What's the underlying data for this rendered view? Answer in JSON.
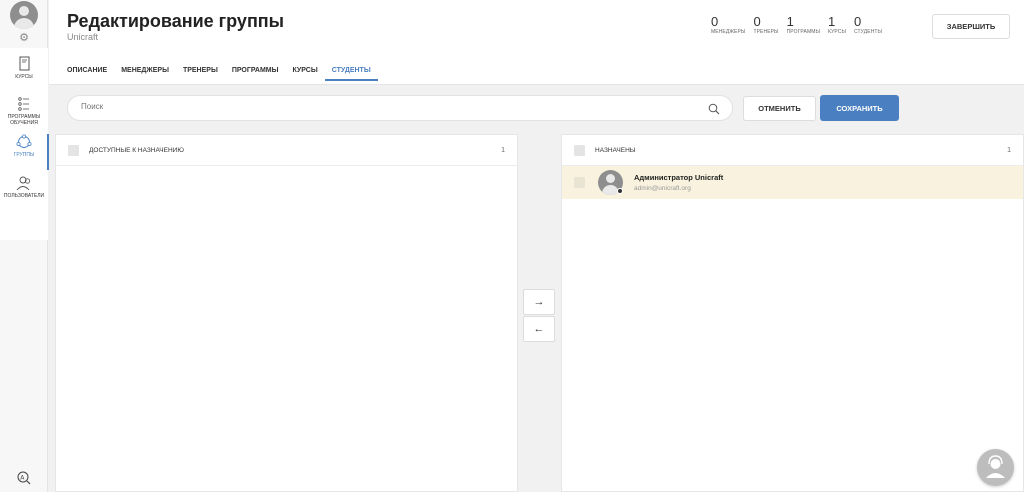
{
  "sidebar": {
    "items": [
      {
        "label": "КУРСЫ",
        "icon": "course-book-icon"
      },
      {
        "label": "ПРОГРАММЫ ОБУЧЕНИЯ",
        "icon": "program-list-icon"
      },
      {
        "label": "ГРУППЫ",
        "icon": "groups-icon"
      },
      {
        "label": "ПОЛЬЗОВАТЕЛИ",
        "icon": "users-icon"
      }
    ],
    "active": "ГРУППЫ"
  },
  "header": {
    "title": "Редактирование группы",
    "subtitle": "Unicraft",
    "finish_label": "ЗАВЕРШИТЬ",
    "stats": [
      {
        "value": "0",
        "label": "МЕНЕДЖЕРЫ"
      },
      {
        "value": "0",
        "label": "ТРЕНЕРЫ"
      },
      {
        "value": "1",
        "label": "ПРОГРАММЫ"
      },
      {
        "value": "1",
        "label": "КУРСЫ"
      },
      {
        "value": "0",
        "label": "СТУДЕНТЫ"
      }
    ],
    "tabs": [
      "ОПИСАНИЕ",
      "МЕНЕДЖЕРЫ",
      "ТРЕНЕРЫ",
      "ПРОГРАММЫ",
      "КУРСЫ",
      "СТУДЕНТЫ"
    ],
    "active_tab": "СТУДЕНТЫ"
  },
  "toolbar": {
    "search_placeholder": "Поиск",
    "cancel_label": "ОТМЕНИТЬ",
    "save_label": "СОХРАНИТЬ"
  },
  "available": {
    "title": "ДОСТУПНЫЕ К НАЗНАЧЕНИЮ",
    "count": "1"
  },
  "assigned": {
    "title": "НАЗНАЧЕНЫ",
    "count": "1",
    "users": [
      {
        "name": "Администратор Unicraft",
        "email": "admin@unicraft.org"
      }
    ]
  },
  "transfer": {
    "right_arrow": "→",
    "left_arrow": "←"
  },
  "colors": {
    "accent": "#4a7fc1",
    "selected_row": "#f8f2de"
  }
}
